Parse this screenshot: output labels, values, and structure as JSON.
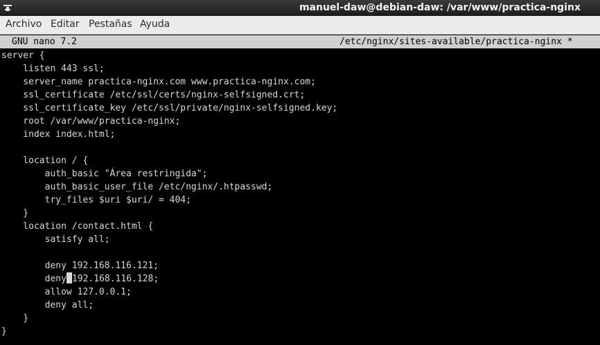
{
  "window": {
    "title": "manuel-daw@debian-daw: /var/www/practica-nginx",
    "icon": "terminal-icon"
  },
  "menu": {
    "items": [
      "Archivo",
      "Editar",
      "Pestañas",
      "Ayuda"
    ]
  },
  "nano": {
    "version": "GNU nano 7.2",
    "filename": "/etc/nginx/sites-available/practica-nginx *"
  },
  "editor": {
    "lines": [
      "server {",
      "    listen 443 ssl;",
      "    server_name practica-nginx.com www.practica-nginx.com;",
      "    ssl_certificate /etc/ssl/certs/nginx-selfsigned.crt;",
      "    ssl_certificate_key /etc/ssl/private/nginx-selfsigned.key;",
      "    root /var/www/practica-nginx;",
      "    index index.html;",
      "",
      "    location / {",
      "        auth_basic \"Área restringida\";",
      "        auth_basic_user_file /etc/nginx/.htpasswd;",
      "        try_files $uri $uri/ = 404;",
      "    }",
      "    location /contact.html {",
      "        satisfy all;",
      "",
      "        deny 192.168.116.121;",
      "        deny 192.168.116.128;",
      "        allow 127.0.0.1;",
      "        deny all;",
      "    }",
      "}"
    ],
    "cursor": {
      "line": 17,
      "column": 12
    }
  },
  "colors": {
    "background": "#000000",
    "text": "#d8d8d8",
    "header_bg": "#d0d0d0",
    "menubar_bg": "#ececec",
    "titlebar_bg": "#2a2a2a"
  }
}
